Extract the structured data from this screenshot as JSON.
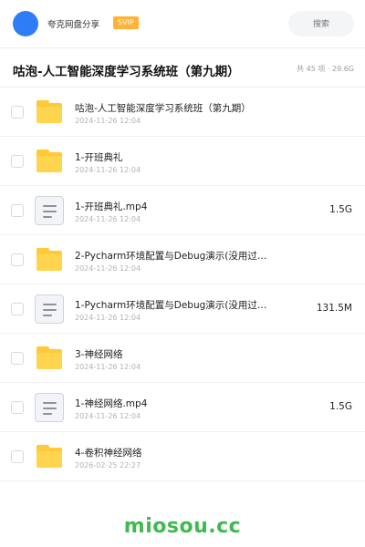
{
  "header": {
    "brand": "夸克网盘分享",
    "badge": "SVIP",
    "search_placeholder": "搜索"
  },
  "share": {
    "title": "咕泡-人工智能深度学习系统班（第九期）",
    "meta": "共 45 项 · 29.6G"
  },
  "items": [
    {
      "type": "folder",
      "name": "咕泡-人工智能深度学习系统班（第九期）",
      "date": "2024-11-26 12:04",
      "size": ""
    },
    {
      "type": "folder",
      "name": "1-开班典礼",
      "date": "2024-11-26 12:04",
      "size": ""
    },
    {
      "type": "file",
      "name": "1-开班典礼.mp4",
      "date": "2024-11-26 12:04",
      "size": "1.5G"
    },
    {
      "type": "folder",
      "name": "2-Pycharm环境配置与Debug演示(没用过…",
      "date": "2024-11-26 12:04",
      "size": ""
    },
    {
      "type": "file",
      "name": "1-Pycharm环境配置与Debug演示(没用过…",
      "date": "2024-11-26 12:04",
      "size": "131.5M"
    },
    {
      "type": "folder",
      "name": "3-神经网络",
      "date": "2024-11-26 12:04",
      "size": ""
    },
    {
      "type": "file",
      "name": "1-神经网络.mp4",
      "date": "2024-11-26 12:04",
      "size": "1.5G"
    },
    {
      "type": "folder",
      "name": "4-卷积神经网络",
      "date": "2026-02-25 22:27",
      "size": ""
    }
  ],
  "footer": {
    "watermark": "miosou.cc"
  },
  "colors": {
    "accent": "#2f7df6",
    "badge": "#ffb233",
    "folder": "#ffc937",
    "watermark": "#3fb950"
  }
}
